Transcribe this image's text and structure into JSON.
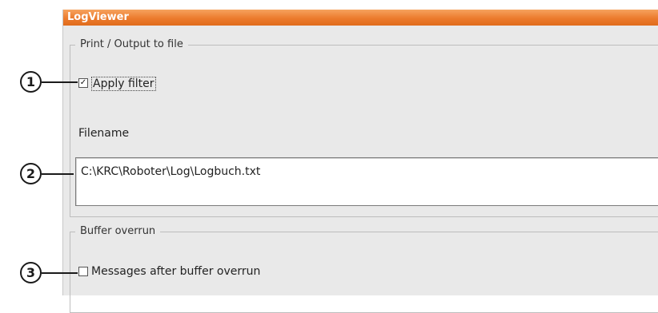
{
  "window": {
    "title": "LogViewer"
  },
  "print_group": {
    "legend": "Print / Output to file",
    "apply_filter": {
      "label": "Apply filter",
      "checked": true,
      "glyph": "✓"
    },
    "filename": {
      "label": "Filename",
      "value": "C:\\KRC\\Roboter\\Log\\Logbuch.txt"
    }
  },
  "buffer_group": {
    "legend": "Buffer overrun",
    "messages_after_overrun": {
      "label": "Messages after buffer overrun",
      "checked": false
    }
  },
  "callouts": [
    "1",
    "2",
    "3"
  ]
}
